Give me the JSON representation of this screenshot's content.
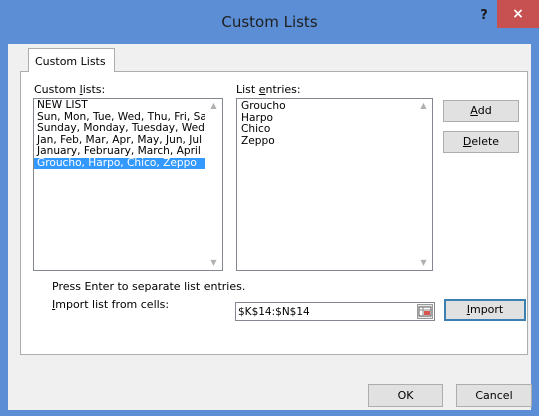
{
  "window": {
    "title": "Custom Lists",
    "help": "?",
    "close": "×"
  },
  "tab": {
    "label": "Custom Lists"
  },
  "custom_lists": {
    "label_pre": "Custom ",
    "label_key": "l",
    "label_post": "ists:",
    "items": [
      "NEW LIST",
      "Sun, Mon, Tue, Wed, Thu, Fri, Sat",
      "Sunday, Monday, Tuesday, Wednesday",
      "Jan, Feb, Mar, Apr, May, Jun, Jul",
      "January, February, March, April",
      "Groucho, Harpo, Chico, Zeppo"
    ],
    "selected_index": 5
  },
  "list_entries": {
    "label_pre": "List ",
    "label_key": "e",
    "label_post": "ntries:",
    "items": [
      "Groucho",
      "Harpo",
      "Chico",
      "Zeppo"
    ]
  },
  "buttons": {
    "add_key": "A",
    "add_rest": "dd",
    "delete_key": "D",
    "delete_rest": "elete",
    "import_key": "I",
    "import_rest": "mport",
    "ok": "OK",
    "cancel": "Cancel"
  },
  "hint": "Press Enter to separate list entries.",
  "import_from": {
    "label_key": "I",
    "label_rest": "mport list from cells:",
    "value": "$K$14:$N$14"
  }
}
